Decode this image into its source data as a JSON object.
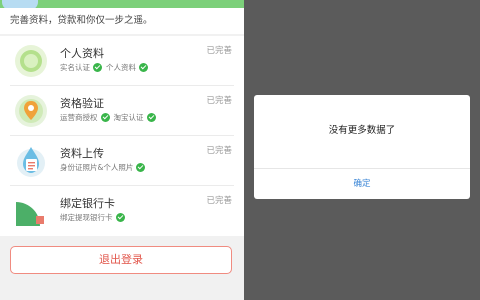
{
  "hint": "完善资料，贷款和你仅一步之遥。",
  "items": [
    {
      "title": "个人资料",
      "status": "已完善",
      "tags": [
        "实名认证",
        "个人资料"
      ]
    },
    {
      "title": "资格验证",
      "status": "已完善",
      "tags": [
        "运营商授权",
        "淘宝认证"
      ]
    },
    {
      "title": "资料上传",
      "status": "已完善",
      "tags": [
        "身份证照片&个人照片"
      ]
    },
    {
      "title": "绑定银行卡",
      "status": "已完善",
      "tags": [
        "绑定提现银行卡"
      ]
    }
  ],
  "logout_label": "退出登录",
  "dialog": {
    "message": "没有更多数据了",
    "confirm_label": "确定"
  },
  "colors": {
    "accent_green": "#39b54a",
    "logout_red": "#e2574c",
    "link_blue": "#3b86d6"
  },
  "icons": {
    "personal": "user-card-icon",
    "qualification": "location-shield-icon",
    "upload": "document-drop-icon",
    "bank": "bank-card-chart-icon"
  }
}
